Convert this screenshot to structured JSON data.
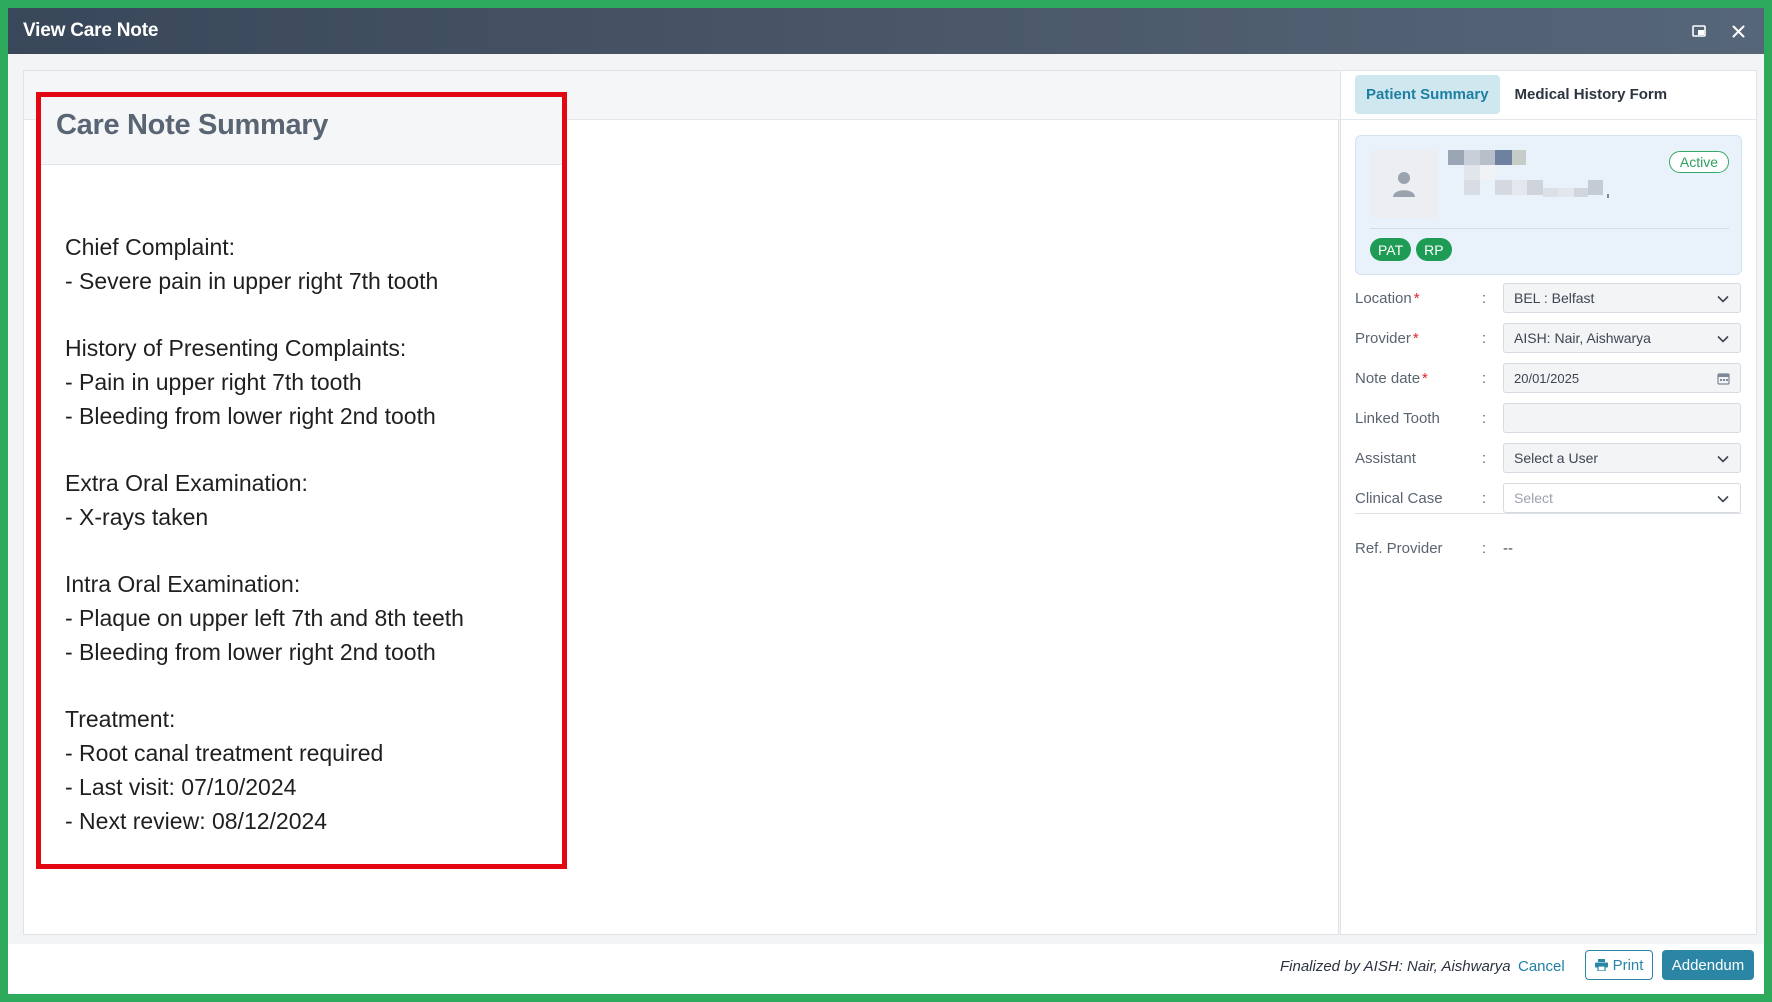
{
  "window": {
    "title": "View Care Note",
    "restore_icon": "restore-window-icon",
    "close_icon": "close-icon"
  },
  "care_note": {
    "title": "Care Note Summary",
    "sections": [
      {
        "heading": "Chief Complaint:",
        "lines": [
          "- Severe pain in upper right 7th tooth"
        ]
      },
      {
        "heading": "History of Presenting Complaints:",
        "lines": [
          "- Pain in upper right 7th tooth",
          "- Bleeding from lower right 2nd tooth"
        ]
      },
      {
        "heading": "Extra Oral Examination:",
        "lines": [
          "- X-rays taken"
        ]
      },
      {
        "heading": "Intra Oral Examination:",
        "lines": [
          "- Plaque on upper left 7th and 8th teeth",
          "- Bleeding from lower right 2nd tooth"
        ]
      },
      {
        "heading": "Treatment:",
        "lines": [
          "- Root canal treatment required",
          "- Last visit: 07/10/2024",
          "- Next review: 08/12/2024"
        ]
      }
    ]
  },
  "right_panel": {
    "tabs": [
      "Patient Summary",
      "Medical History Form"
    ],
    "active_tab": "Patient Summary",
    "patient": {
      "status": "Active",
      "tags": [
        "PAT",
        "RP"
      ],
      "avatar_icon": "user-icon"
    },
    "form": {
      "location": {
        "label": "Location",
        "value": "BEL : Belfast",
        "required": true
      },
      "provider": {
        "label": "Provider",
        "value": "AISH: Nair, Aishwarya",
        "required": true
      },
      "note_date": {
        "label": "Note date",
        "value": "20/01/2025",
        "required": true
      },
      "linked_tooth": {
        "label": "Linked Tooth",
        "value": ""
      },
      "assistant": {
        "label": "Assistant",
        "value": "Select a User"
      },
      "clinical_case": {
        "label": "Clinical Case",
        "placeholder": "Select"
      },
      "ref_provider": {
        "label": "Ref. Provider",
        "value": "--"
      },
      "required_mark": "*",
      "separator": ":"
    }
  },
  "footer": {
    "finalized_text": "Finalized by AISH: Nair, Aishwarya",
    "cancel_label": "Cancel",
    "print_label": "Print",
    "addendum_label": "Addendum"
  },
  "colors": {
    "frame_green": "#2eaa5c",
    "highlight_red": "#e30613",
    "accent_teal": "#2b86a5",
    "tag_green": "#1e9b55"
  }
}
